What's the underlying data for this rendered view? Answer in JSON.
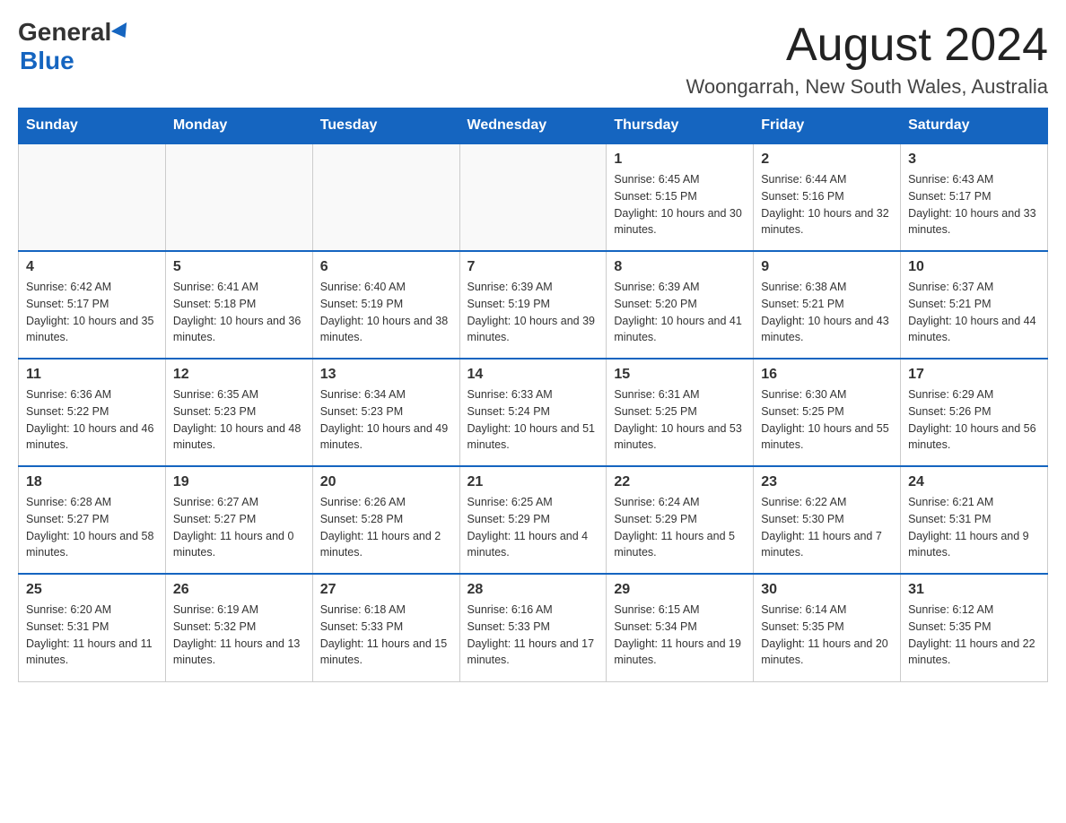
{
  "header": {
    "logo_general": "General",
    "logo_blue": "Blue",
    "month_title": "August 2024",
    "location": "Woongarrah, New South Wales, Australia"
  },
  "weekdays": [
    "Sunday",
    "Monday",
    "Tuesday",
    "Wednesday",
    "Thursday",
    "Friday",
    "Saturday"
  ],
  "weeks": [
    [
      {
        "day": "",
        "info": ""
      },
      {
        "day": "",
        "info": ""
      },
      {
        "day": "",
        "info": ""
      },
      {
        "day": "",
        "info": ""
      },
      {
        "day": "1",
        "info": "Sunrise: 6:45 AM\nSunset: 5:15 PM\nDaylight: 10 hours and 30 minutes."
      },
      {
        "day": "2",
        "info": "Sunrise: 6:44 AM\nSunset: 5:16 PM\nDaylight: 10 hours and 32 minutes."
      },
      {
        "day": "3",
        "info": "Sunrise: 6:43 AM\nSunset: 5:17 PM\nDaylight: 10 hours and 33 minutes."
      }
    ],
    [
      {
        "day": "4",
        "info": "Sunrise: 6:42 AM\nSunset: 5:17 PM\nDaylight: 10 hours and 35 minutes."
      },
      {
        "day": "5",
        "info": "Sunrise: 6:41 AM\nSunset: 5:18 PM\nDaylight: 10 hours and 36 minutes."
      },
      {
        "day": "6",
        "info": "Sunrise: 6:40 AM\nSunset: 5:19 PM\nDaylight: 10 hours and 38 minutes."
      },
      {
        "day": "7",
        "info": "Sunrise: 6:39 AM\nSunset: 5:19 PM\nDaylight: 10 hours and 39 minutes."
      },
      {
        "day": "8",
        "info": "Sunrise: 6:39 AM\nSunset: 5:20 PM\nDaylight: 10 hours and 41 minutes."
      },
      {
        "day": "9",
        "info": "Sunrise: 6:38 AM\nSunset: 5:21 PM\nDaylight: 10 hours and 43 minutes."
      },
      {
        "day": "10",
        "info": "Sunrise: 6:37 AM\nSunset: 5:21 PM\nDaylight: 10 hours and 44 minutes."
      }
    ],
    [
      {
        "day": "11",
        "info": "Sunrise: 6:36 AM\nSunset: 5:22 PM\nDaylight: 10 hours and 46 minutes."
      },
      {
        "day": "12",
        "info": "Sunrise: 6:35 AM\nSunset: 5:23 PM\nDaylight: 10 hours and 48 minutes."
      },
      {
        "day": "13",
        "info": "Sunrise: 6:34 AM\nSunset: 5:23 PM\nDaylight: 10 hours and 49 minutes."
      },
      {
        "day": "14",
        "info": "Sunrise: 6:33 AM\nSunset: 5:24 PM\nDaylight: 10 hours and 51 minutes."
      },
      {
        "day": "15",
        "info": "Sunrise: 6:31 AM\nSunset: 5:25 PM\nDaylight: 10 hours and 53 minutes."
      },
      {
        "day": "16",
        "info": "Sunrise: 6:30 AM\nSunset: 5:25 PM\nDaylight: 10 hours and 55 minutes."
      },
      {
        "day": "17",
        "info": "Sunrise: 6:29 AM\nSunset: 5:26 PM\nDaylight: 10 hours and 56 minutes."
      }
    ],
    [
      {
        "day": "18",
        "info": "Sunrise: 6:28 AM\nSunset: 5:27 PM\nDaylight: 10 hours and 58 minutes."
      },
      {
        "day": "19",
        "info": "Sunrise: 6:27 AM\nSunset: 5:27 PM\nDaylight: 11 hours and 0 minutes."
      },
      {
        "day": "20",
        "info": "Sunrise: 6:26 AM\nSunset: 5:28 PM\nDaylight: 11 hours and 2 minutes."
      },
      {
        "day": "21",
        "info": "Sunrise: 6:25 AM\nSunset: 5:29 PM\nDaylight: 11 hours and 4 minutes."
      },
      {
        "day": "22",
        "info": "Sunrise: 6:24 AM\nSunset: 5:29 PM\nDaylight: 11 hours and 5 minutes."
      },
      {
        "day": "23",
        "info": "Sunrise: 6:22 AM\nSunset: 5:30 PM\nDaylight: 11 hours and 7 minutes."
      },
      {
        "day": "24",
        "info": "Sunrise: 6:21 AM\nSunset: 5:31 PM\nDaylight: 11 hours and 9 minutes."
      }
    ],
    [
      {
        "day": "25",
        "info": "Sunrise: 6:20 AM\nSunset: 5:31 PM\nDaylight: 11 hours and 11 minutes."
      },
      {
        "day": "26",
        "info": "Sunrise: 6:19 AM\nSunset: 5:32 PM\nDaylight: 11 hours and 13 minutes."
      },
      {
        "day": "27",
        "info": "Sunrise: 6:18 AM\nSunset: 5:33 PM\nDaylight: 11 hours and 15 minutes."
      },
      {
        "day": "28",
        "info": "Sunrise: 6:16 AM\nSunset: 5:33 PM\nDaylight: 11 hours and 17 minutes."
      },
      {
        "day": "29",
        "info": "Sunrise: 6:15 AM\nSunset: 5:34 PM\nDaylight: 11 hours and 19 minutes."
      },
      {
        "day": "30",
        "info": "Sunrise: 6:14 AM\nSunset: 5:35 PM\nDaylight: 11 hours and 20 minutes."
      },
      {
        "day": "31",
        "info": "Sunrise: 6:12 AM\nSunset: 5:35 PM\nDaylight: 11 hours and 22 minutes."
      }
    ]
  ]
}
